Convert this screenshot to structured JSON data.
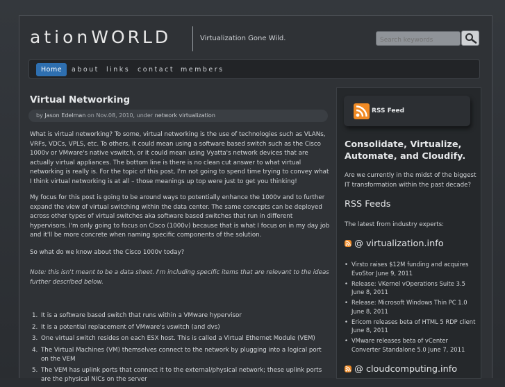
{
  "site": {
    "logo_part1": "ation",
    "logo_part2": "WORLD",
    "tagline": "Virtualization Gone Wild."
  },
  "search": {
    "placeholder": "Search keywords",
    "icon": "magnifier-icon"
  },
  "nav": {
    "items": [
      "Home",
      "about",
      "links",
      "contact",
      "members"
    ],
    "active": "Home"
  },
  "post": {
    "title": "Virtual Networking",
    "byline_prefix": "by",
    "author": "Jason Edelman",
    "byline_on": "on Nov.08, 2010, under",
    "category": "network virtualization",
    "paragraphs": [
      "What is virtual networking? To some, virtual networking is the use of technologies such as VLANs, VRFs, VDCs, VPLS, etc.  To others, it could mean using a software based switch such as the Cisco 1000v or VMware's native vswitch, or it could mean using Vyatta's network devices that are actually virtual appliances.  The bottom line is there is no clean cut answer to what virtual networking is really is.  For the topic of this post, I'm not going to spend time trying to convey what I think virtual networking is at all – those meanings up top were just to get you thinking!",
      "My focus for this post is going to be around ways to potentially enhance the 1000v and to further expand the view of virtual switching within the data center.  The same concepts can be deployed across other types of virtual switches aka software based switches that run in different hypervisors.  I'm only going to focus on Cisco (1000v) because that is what I focus on in my day job and it'll be more concrete when naming specific components of the solution.",
      "So what do we know about the Cisco 1000v today?",
      "Note: this isn't meant to be a data sheet.  I'm including specific items that are relevant to the ideas further described below."
    ],
    "list": [
      "It is a software based switch that runs within a VMware hypervisor",
      "It is a potential replacement of VMware's vswitch (and dvs)",
      "One virtual switch resides on each ESX host.  This is called a Virtual Ethernet Module (VEM)",
      "The Virtual Machines (VM) themselves connect to the network by plugging into a logical port on the VEM",
      "The VEM has uplink ports that connect it to the external/physical network; these uplink ports are the physical NICs on the server"
    ]
  },
  "sidebar": {
    "rss_label": "RSS Feed",
    "heading": "Consolidate, Virtualize, Automate, and Cloudify.",
    "question": "Are we currently in the midst of the biggest IT transformation within the past decade?",
    "rss_feeds_heading": "RSS Feeds",
    "rss_feeds_text": "The latest from industry experts:",
    "feed1": {
      "title": "@ virtualization.info",
      "items": [
        "Virsto raises $12M funding and acquires EvoStor June 9, 2011",
        "Release: VKernel vOperations Suite 3.5 June 8, 2011",
        "Release: Microsoft Windows Thin PC 1.0 June 8, 2011",
        "Ericom releases beta of HTML 5 RDP client June 8, 2011",
        "VMware releases beta of vCenter Converter Standalone 5.0 June 7, 2011"
      ]
    },
    "feed2": {
      "title": "@ cloudcomputing.info"
    }
  },
  "colors": {
    "accent": "#2e6fb0",
    "rss_orange": "#f08a24",
    "background": "#2f3236"
  }
}
